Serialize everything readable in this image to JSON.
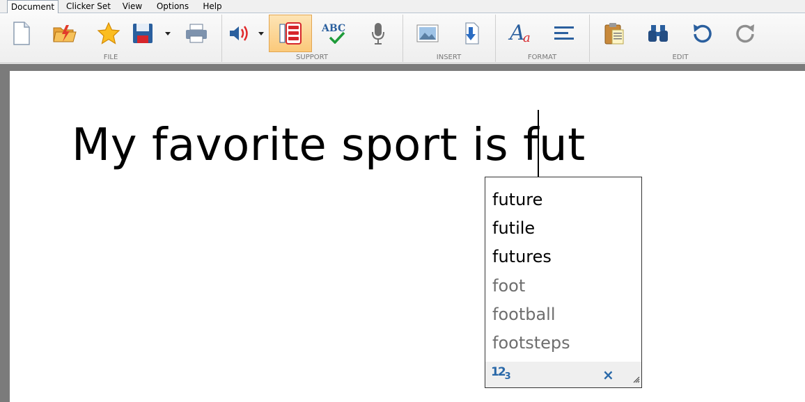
{
  "menu": {
    "document": "Document",
    "clicker_set": "Clicker Set",
    "view": "View",
    "options": "Options",
    "help": "Help"
  },
  "ribbon": {
    "groups": {
      "file": "FILE",
      "support": "SUPPORT",
      "insert": "INSERT",
      "format": "FORMAT",
      "edit": "EDIT"
    },
    "abc_label": "ABC",
    "format_glyph": "A",
    "format_glyph_sub": "a"
  },
  "document": {
    "text": "My favorite sport is fut"
  },
  "predictor": {
    "words": [
      {
        "text": "future",
        "style": "strong"
      },
      {
        "text": "futile",
        "style": "strong"
      },
      {
        "text": "futures",
        "style": "strong"
      },
      {
        "text": "foot",
        "style": "weak"
      },
      {
        "text": "football",
        "style": "weak"
      },
      {
        "text": "footsteps",
        "style": "weak"
      }
    ],
    "numbers_icon": "12",
    "numbers_icon_sub": "3",
    "close_glyph": "×"
  },
  "colors": {
    "accent_blue": "#2968a8",
    "active_tool": "#fbc97a"
  }
}
